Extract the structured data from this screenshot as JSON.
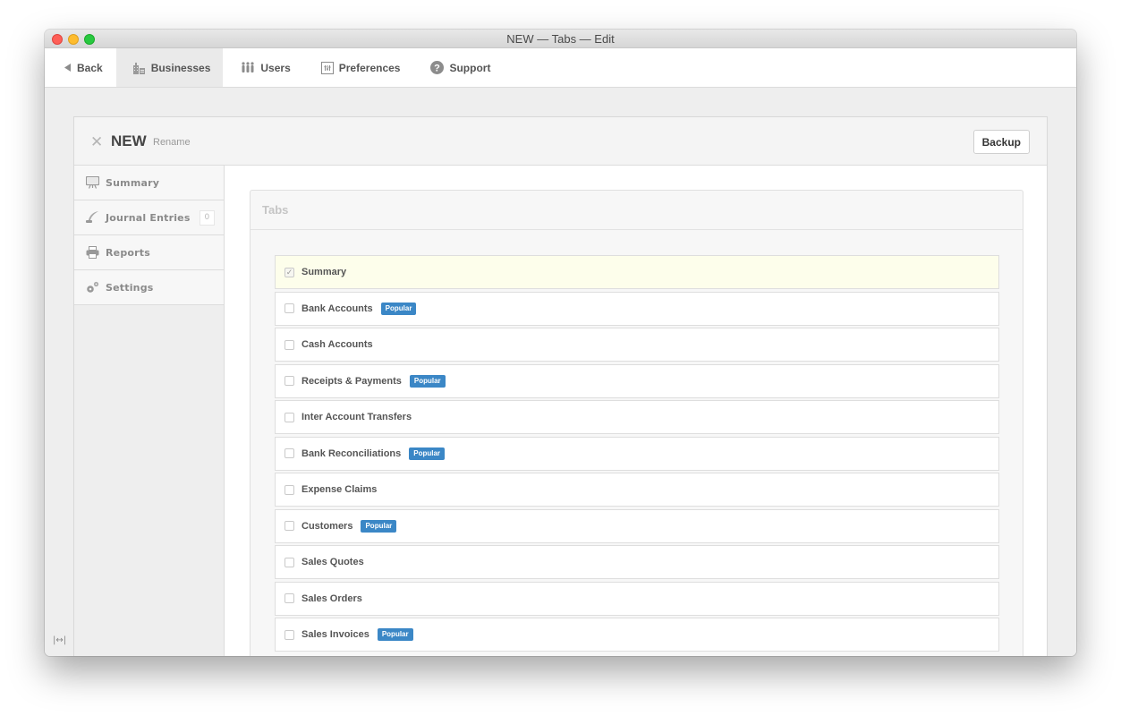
{
  "window": {
    "title": "NEW — Tabs — Edit"
  },
  "topnav": {
    "items": [
      {
        "label": "Back",
        "icon": "back-triangle-icon"
      },
      {
        "label": "Businesses",
        "icon": "buildings-icon",
        "active": true
      },
      {
        "label": "Users",
        "icon": "users-icon"
      },
      {
        "label": "Preferences",
        "icon": "preferences-icon"
      },
      {
        "label": "Support",
        "icon": "question-circle-icon"
      }
    ]
  },
  "business": {
    "name": "NEW",
    "rename_label": "Rename",
    "backup_label": "Backup"
  },
  "sidebar": {
    "items": [
      {
        "label": "Summary",
        "icon": "monitor-icon"
      },
      {
        "label": "Journal Entries",
        "icon": "quill-icon",
        "badge": "0"
      },
      {
        "label": "Reports",
        "icon": "printer-icon"
      },
      {
        "label": "Settings",
        "icon": "gears-icon"
      }
    ]
  },
  "tabs_panel": {
    "title": "Tabs",
    "popular_label": "Popular",
    "items": [
      {
        "label": "Summary",
        "checked": true,
        "popular": false
      },
      {
        "label": "Bank Accounts",
        "checked": false,
        "popular": true
      },
      {
        "label": "Cash Accounts",
        "checked": false,
        "popular": false
      },
      {
        "label": "Receipts & Payments",
        "checked": false,
        "popular": true
      },
      {
        "label": "Inter Account Transfers",
        "checked": false,
        "popular": false
      },
      {
        "label": "Bank Reconciliations",
        "checked": false,
        "popular": true
      },
      {
        "label": "Expense Claims",
        "checked": false,
        "popular": false
      },
      {
        "label": "Customers",
        "checked": false,
        "popular": true
      },
      {
        "label": "Sales Quotes",
        "checked": false,
        "popular": false
      },
      {
        "label": "Sales Orders",
        "checked": false,
        "popular": false
      },
      {
        "label": "Sales Invoices",
        "checked": false,
        "popular": true
      }
    ]
  },
  "footer": {
    "resize_icon": "|↔|"
  },
  "colors": {
    "popular_badge": "#3b87c6",
    "checked_row": "#fdfeeb"
  }
}
